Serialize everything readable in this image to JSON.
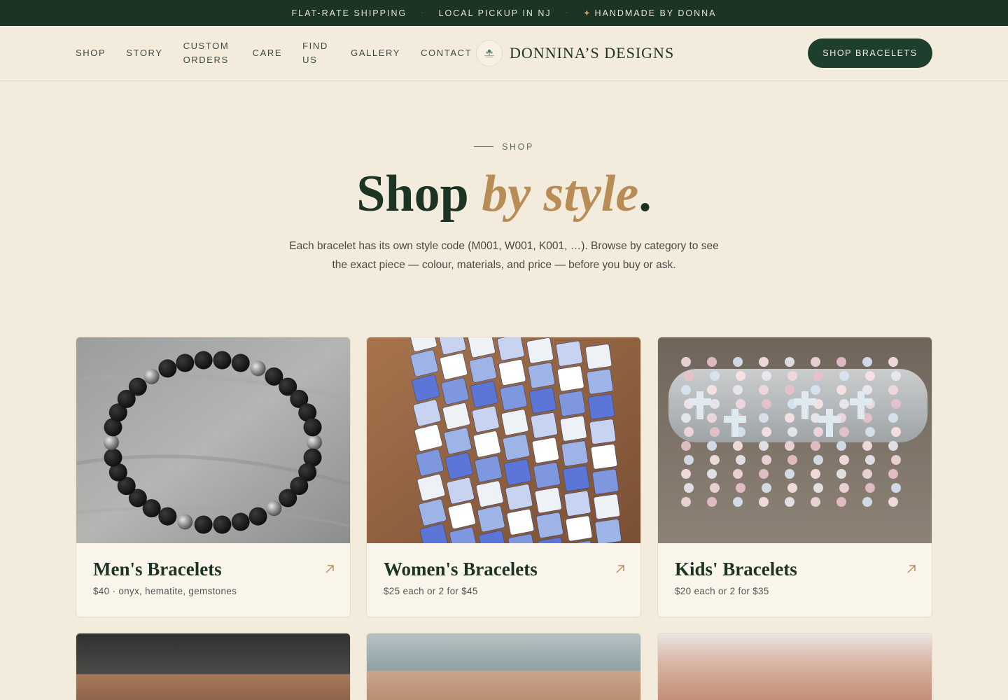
{
  "announcement": {
    "items": [
      "FLAT-RATE SHIPPING",
      "LOCAL PICKUP IN NJ",
      "HANDMADE BY DONNA"
    ],
    "separator": "·",
    "star": "✦"
  },
  "nav": {
    "items": [
      "SHOP",
      "STORY",
      "CUSTOM ORDERS",
      "CARE",
      "FIND US",
      "GALLERY",
      "CONTACT"
    ]
  },
  "brand": {
    "name": "DONNINA’S DESIGNS",
    "icon": "logo-emblem"
  },
  "cta": {
    "label": "SHOP BRACELETS"
  },
  "hero": {
    "eyebrow": "SHOP",
    "title_plain": "Shop ",
    "title_accent": "by style",
    "title_end": ".",
    "lede": "Each bracelet has its own style code (M001, W001, K001, …). Browse by category to see the exact piece — colour, materials, and price — before you buy or ask."
  },
  "cards": [
    {
      "name": "Men's Bracelets",
      "price": "$40 · onyx, hematite, gemstones",
      "icon": "arrow-up-right-icon"
    },
    {
      "name": "Women's Bracelets",
      "price": "$25 each or 2 for $45",
      "icon": "arrow-up-right-icon"
    },
    {
      "name": "Kids' Bracelets",
      "price": "$20 each or 2 for $35",
      "icon": "arrow-up-right-icon"
    }
  ],
  "colors": {
    "dark_green": "#1b3424",
    "accent_gold": "#b88d55",
    "background": "#f3ebdc"
  }
}
